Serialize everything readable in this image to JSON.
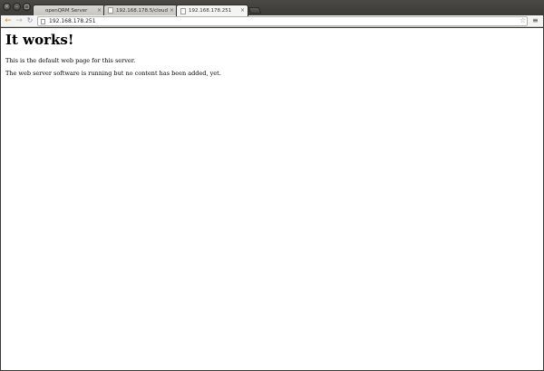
{
  "window": {
    "controls": {
      "close_glyph": "×",
      "min_glyph": "–",
      "max_glyph": "□"
    }
  },
  "tabs": [
    {
      "label": "openQRM Server",
      "favicon": "blank",
      "active": false
    },
    {
      "label": "192.168.178.5/cloud-portal",
      "favicon": "page-icon",
      "active": false
    },
    {
      "label": "192.168.178.251",
      "favicon": "page-icon",
      "active": true
    }
  ],
  "tab_close_glyph": "×",
  "toolbar": {
    "back_glyph": "←",
    "forward_glyph": "→",
    "reload_glyph": "↻",
    "url": "192.168.178.251",
    "star_glyph": "☆",
    "menu_glyph": "≡"
  },
  "page": {
    "heading": "It works!",
    "paragraphs": [
      "This is the default web page for this server.",
      "The web server software is running but no content has been added, yet."
    ]
  },
  "colors": {
    "back_icon": "#d98a2b",
    "reload_icon": "#6d8fc4"
  }
}
